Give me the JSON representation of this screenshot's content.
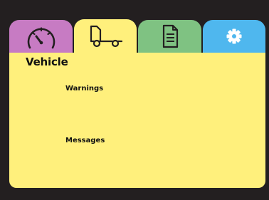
{
  "colors": {
    "background": "#231f20",
    "tab_speed": "#c77bc3",
    "tab_vehicle": "#fff07c",
    "tab_docs": "#7fc282",
    "tab_settings": "#4fb7ee",
    "panel": "#fff07c",
    "icon_stroke": "#231f20",
    "gear_fill": "#ffffff"
  },
  "tabs": [
    {
      "id": "speed",
      "icon": "speedometer-icon",
      "active": false
    },
    {
      "id": "vehicle",
      "icon": "truck-icon",
      "active": true
    },
    {
      "id": "documents",
      "icon": "document-icon",
      "active": false
    },
    {
      "id": "settings",
      "icon": "gear-icon",
      "active": false
    }
  ],
  "panel": {
    "title": "Vehicle",
    "items": [
      {
        "label": "Warnings"
      },
      {
        "label": "Messages"
      }
    ]
  }
}
